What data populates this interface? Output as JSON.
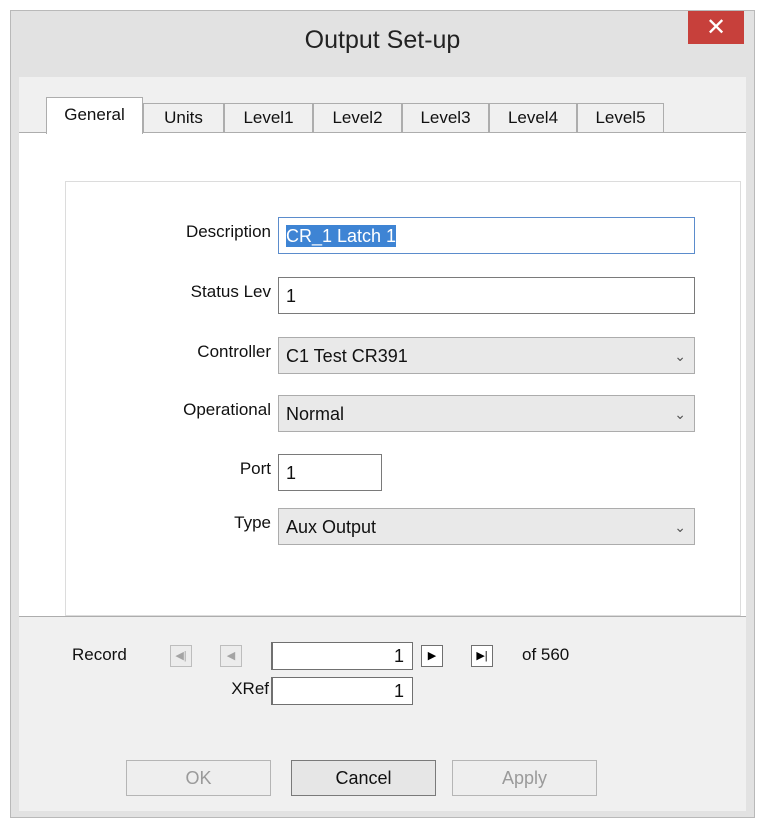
{
  "window": {
    "title": "Output Set-up",
    "close_glyph": "✕"
  },
  "tabs": [
    {
      "label": "General",
      "active": true
    },
    {
      "label": "Units",
      "active": false
    },
    {
      "label": "Level1",
      "active": false
    },
    {
      "label": "Level2",
      "active": false
    },
    {
      "label": "Level3",
      "active": false
    },
    {
      "label": "Level4",
      "active": false
    },
    {
      "label": "Level5",
      "active": false
    }
  ],
  "form": {
    "description": {
      "label": "Description",
      "value": "CR_1 Latch 1"
    },
    "status_lev": {
      "label": "Status Lev",
      "value": "1"
    },
    "controller": {
      "label": "Controller",
      "value": "C1 Test CR391"
    },
    "operational": {
      "label": "Operational",
      "value": "Normal"
    },
    "port": {
      "label": "Port",
      "value": "1"
    },
    "type": {
      "label": "Type",
      "value": "Aux Output"
    }
  },
  "record": {
    "label": "Record",
    "value": "1",
    "of_text": "of 560",
    "first_icon": "first-record-icon",
    "prev_icon": "previous-record-icon",
    "next_icon": "next-record-icon",
    "last_icon": "last-record-icon"
  },
  "xref": {
    "label": "XRef",
    "value": "1"
  },
  "buttons": {
    "ok": "OK",
    "cancel": "Cancel",
    "apply": "Apply"
  },
  "icons": {
    "combo_arrow": "chevron-down-icon"
  }
}
